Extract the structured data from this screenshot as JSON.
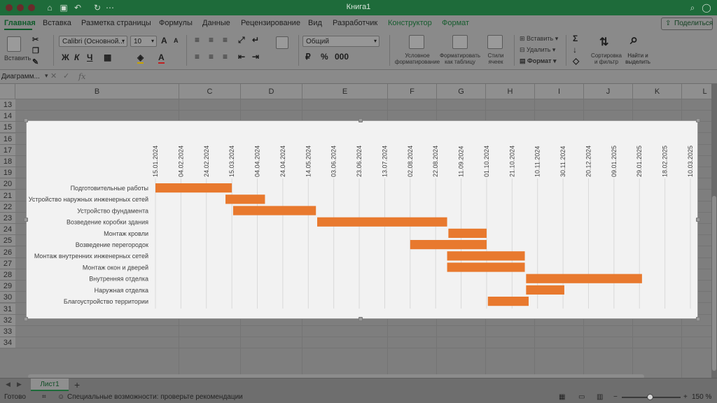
{
  "window": {
    "title": "Книга1"
  },
  "tabs": [
    "Главная",
    "Вставка",
    "Разметка страницы",
    "Формулы",
    "Данные",
    "Рецензирование",
    "Вид",
    "Разработчик",
    "Конструктор",
    "Формат"
  ],
  "share_label": "Поделиться",
  "ribbon": {
    "paste_label": "Вставить",
    "font_name": "Calibri (Основной...",
    "font_size": "10",
    "bold": "Ж",
    "italic": "К",
    "underline": "Ч",
    "font_color_glyph": "А",
    "number_format": "Общий",
    "cond_format_label": "Условное\nформатирование",
    "format_table_label": "Форматировать\nкак таблицу",
    "cell_styles_label": "Стили\nячеек",
    "insert_label": "Вставить",
    "delete_label": "Удалить",
    "format_label": "Формат",
    "sort_filter_label": "Сортировка\nи фильтр",
    "find_select_label": "Найти и\nвыделить"
  },
  "formula_bar": {
    "name_box": "Диаграмм...",
    "fx": "fx"
  },
  "sheet": {
    "columns": [
      "B",
      "C",
      "D",
      "E",
      "F",
      "G",
      "H",
      "I",
      "J",
      "K",
      "L"
    ],
    "rows": [
      "13",
      "14",
      "15",
      "16",
      "17",
      "18",
      "19",
      "20",
      "21",
      "22",
      "23",
      "24",
      "25",
      "26",
      "27",
      "28",
      "29",
      "30",
      "31",
      "32",
      "33",
      "34"
    ]
  },
  "chart_data": {
    "type": "bar",
    "orientation": "horizontal-gantt",
    "bar_color": "#e8792e",
    "axis_start": "2024-01-15",
    "axis_end": "2025-03-10",
    "ticks": [
      "15.01.2024",
      "04.02.2024",
      "24.02.2024",
      "15.03.2024",
      "04.04.2024",
      "24.04.2024",
      "14.05.2024",
      "03.06.2024",
      "23.06.2024",
      "13.07.2024",
      "02.08.2024",
      "22.08.2024",
      "11.09.2024",
      "01.10.2024",
      "21.10.2024",
      "10.11.2024",
      "30.11.2024",
      "20.12.2024",
      "09.01.2025",
      "29.01.2025",
      "18.02.2025",
      "10.03.2025"
    ],
    "tasks": [
      {
        "name": "Подготовительные работы",
        "start": "2024-01-15",
        "end": "2024-03-15"
      },
      {
        "name": "Устройство наружных инженерных сетей",
        "start": "2024-03-10",
        "end": "2024-04-10"
      },
      {
        "name": "Устройство фундамента",
        "start": "2024-03-16",
        "end": "2024-05-20"
      },
      {
        "name": "Возведение коробки здания",
        "start": "2024-05-21",
        "end": "2024-08-31"
      },
      {
        "name": "Монтаж кровли",
        "start": "2024-09-01",
        "end": "2024-10-01"
      },
      {
        "name": "Возведение перегородок",
        "start": "2024-08-02",
        "end": "2024-10-01"
      },
      {
        "name": "Монтаж внутренних инженерных сетей",
        "start": "2024-08-31",
        "end": "2024-10-31"
      },
      {
        "name": "Монтаж окон и дверей",
        "start": "2024-08-31",
        "end": "2024-10-31"
      },
      {
        "name": "Внутренняя отделка",
        "start": "2024-11-01",
        "end": "2025-01-31"
      },
      {
        "name": "Наружная отделка",
        "start": "2024-11-01",
        "end": "2024-12-01"
      },
      {
        "name": "Благоустройство территории",
        "start": "2024-10-02",
        "end": "2024-11-03"
      }
    ],
    "grid": true
  },
  "sheet_tab": "Лист1",
  "status": {
    "ready": "Готово",
    "accessibility": "Специальные возможности: проверьте рекомендации",
    "zoom": "150 %"
  }
}
